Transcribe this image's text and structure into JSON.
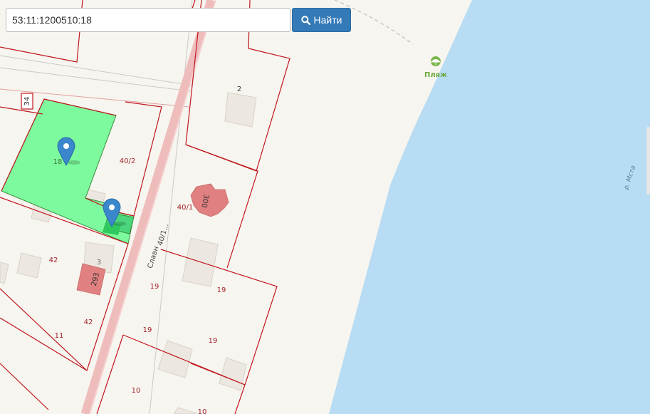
{
  "search": {
    "value": "53:11:1200510:18",
    "button_label": "Найти",
    "button_icon": "search-icon"
  },
  "map": {
    "colors": {
      "background": "#f7f5ef",
      "water": "#b7dcf3",
      "parcel_border": "#c0161f",
      "parcel_label": "#a3242b",
      "selected_parcel": "#7dfa9e",
      "road": "#efbcbc",
      "building": "#ece8e1",
      "residential_building": "#e08080",
      "marker": "#3a87cc",
      "poi": "#7ab64a"
    },
    "poi_beach": {
      "label": "Пляж",
      "icon": "beach-icon"
    },
    "river_label": "р. Мста",
    "street_label": "Славн",
    "street_address_label": "40/1...",
    "block_number": "34",
    "parcel_labels": {
      "p18": "18",
      "p40_2": "40/2",
      "p2": "2",
      "p40_1": "40/1",
      "p42a": "42",
      "p42b": "42",
      "p11": "11",
      "p19a": "19",
      "p19b": "19",
      "p19c": "19",
      "p19d": "19",
      "p10a": "10",
      "p10b": "10",
      "p3": "3"
    },
    "building_numbers": {
      "b300": "300",
      "b293": "293"
    },
    "marker_count": 2
  }
}
